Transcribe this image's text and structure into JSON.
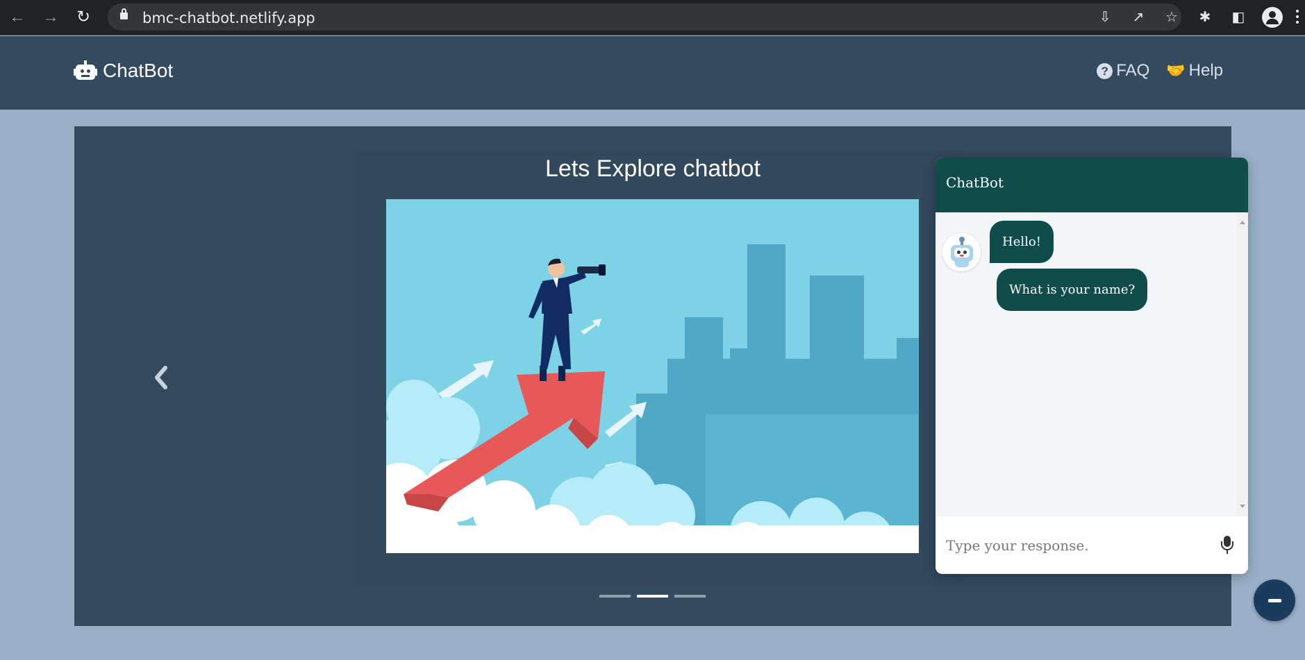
{
  "browser": {
    "url": "bmc-chatbot.netlify.app",
    "back_icon": "arrow-left-icon",
    "forward_icon": "arrow-right-icon",
    "reload_icon": "reload-icon"
  },
  "navbar": {
    "brand": "ChatBot",
    "links": [
      {
        "label": "FAQ",
        "icon": "question-circle-icon"
      },
      {
        "label": "Help",
        "icon": "handshake-icon"
      }
    ],
    "background": "#344a5f"
  },
  "carousel": {
    "title": "Lets Explore chatbot",
    "active_index": 1,
    "indicator_count": 3
  },
  "chat": {
    "title": "ChatBot",
    "messages": [
      {
        "from": "bot",
        "text": "Hello!"
      },
      {
        "from": "bot",
        "text": "What is your name?"
      }
    ],
    "input_placeholder": "Type your response.",
    "header_color": "#0f4c4a"
  }
}
